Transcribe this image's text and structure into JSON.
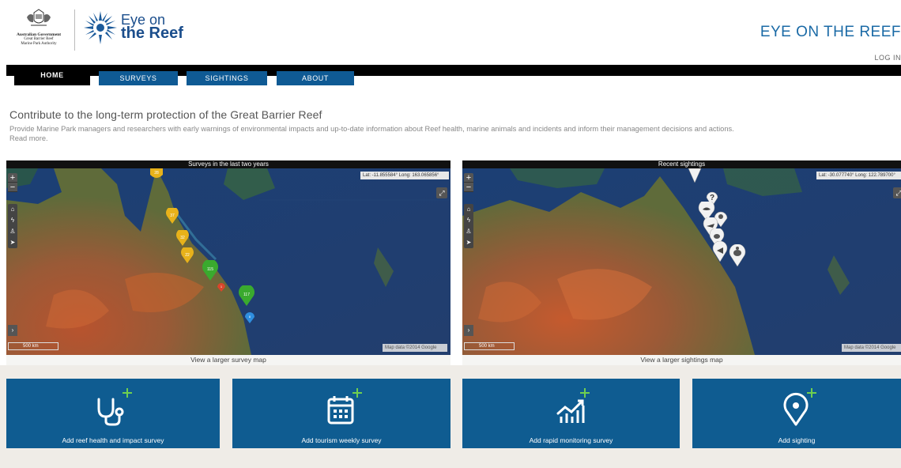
{
  "header": {
    "gov_logo_lines": [
      "Australian Government",
      "Great Barrier Reef",
      "Marine Park Authority"
    ],
    "brand_line1": "Eye on",
    "brand_line2": "the Reef",
    "site_title": "EYE ON THE REEF",
    "login_label": "LOG IN"
  },
  "nav": {
    "tabs": [
      {
        "label": "HOME",
        "active": true
      },
      {
        "label": "SURVEYS",
        "active": false
      },
      {
        "label": "SIGHTINGS",
        "active": false
      },
      {
        "label": "ABOUT",
        "active": false
      }
    ]
  },
  "intro": {
    "title": "Contribute to the long-term protection of the Great Barrier Reef",
    "text": "Provide Marine Park managers and researchers with early warnings of environmental impacts and up-to-date information about Reef health, marine animals and incidents and inform their management decisions and actions.",
    "read_more": "Read more."
  },
  "maps": {
    "surveys": {
      "title": "Surveys in the last two years",
      "coords": "Lat: -11.855584° Long: 163.065856°",
      "scale": "500 km",
      "attribution": "Map data ©2014 Google",
      "link": "View a larger survey map",
      "markers": [
        "28",
        "37",
        "32",
        "22",
        "115",
        "1",
        "117",
        "8"
      ]
    },
    "sightings": {
      "title": "Recent sightings",
      "coords": "Lat: -30.077740° Long: 122.789700°",
      "scale": "500 km",
      "attribution": "Map data ©2014 Google",
      "link": "View a larger sightings map"
    }
  },
  "actions": [
    {
      "label": "Add reef health and impact survey",
      "icon": "stethoscope-icon"
    },
    {
      "label": "Add tourism weekly survey",
      "icon": "calendar-icon"
    },
    {
      "label": "Add rapid monitoring survey",
      "icon": "chart-icon"
    },
    {
      "label": "Add sighting",
      "icon": "location-pin-icon"
    }
  ],
  "colors": {
    "brand_blue": "#0f5c91",
    "title_blue": "#1a6aa6",
    "nav_black": "#000000",
    "marker_yellow": "#e8b21a",
    "marker_green": "#3aaa2e",
    "marker_blue": "#2f8fe0",
    "marker_red": "#d9452b"
  }
}
